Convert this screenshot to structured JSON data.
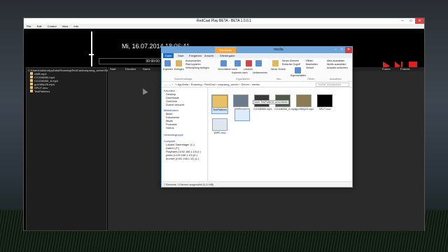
{
  "app": {
    "title": "RedCast Play BETA - BETA 1.0.0.1",
    "menu": [
      "File",
      "Edit",
      "Control",
      "View",
      "Info"
    ],
    "clock": "Mi, 16.07.2014 18:06:41",
    "time": "00:00:00",
    "accent": "#e02020"
  },
  "tree": {
    "root": "C:\\Users\\oddso\\AppData\\Roaming\\RedCast\\casparcg_server\\Server",
    "items": [
      "AMB.mp4",
      "CG1080i50.mp4",
      "CG1080i50_A.mp4",
      "go1080p25.mp4",
      "SPLIT.mov",
      "TestPatterns"
    ]
  },
  "columns": [
    "Start",
    "Duration",
    "Name",
    "Frame",
    "Frames"
  ],
  "explorer": {
    "title": "media",
    "context_tab": "Videotools",
    "tabs": [
      "Datei",
      "Start",
      "Freigeben",
      "Ansicht",
      "Wiedergabe"
    ],
    "ribbon": {
      "kopieren": "Kopieren",
      "einfuegen": "Einfügen",
      "ausschneiden": "Ausschneiden",
      "pfad": "Pfad kopieren",
      "verknuepfung": "Verknüpfung einfügen",
      "verschieben": "Verschieben nach",
      "kopieren_nach": "Kopieren nach",
      "loeschen": "Löschen",
      "umbenennen": "Umbenennen",
      "neuer_ordner": "Neuer Ordner",
      "neues_element": "Neues Element",
      "einfacher_zugriff": "Einfacher Zugriff",
      "eigenschaften": "Eigenschaften",
      "oeffnen": "Öffnen",
      "bearbeiten": "Bearbeiten",
      "verlauf": "Verlauf",
      "alles_auswaehlen": "Alles auswählen",
      "nichts_auswaehlen": "Nichts auswählen",
      "auswahl_umkehren": "Auswahl umkehren",
      "groups": [
        "Zwischenablage",
        "Organisieren",
        "Neu",
        "Öffnen",
        "Auswählen"
      ]
    },
    "address": "« AppData › Roaming › RedCast › casparcg_server › Server › media",
    "search": "\"media\" durchsuchen",
    "nav": {
      "favoriten": "Favoriten",
      "fav_items": [
        "Desktop",
        "Downloads",
        "OneDrive",
        "Zuletzt besucht"
      ],
      "bibliotheken": "Bibliotheken",
      "lib_items": [
        "Bilder",
        "Dokumente",
        "Musik",
        "Podcasts",
        "Videos"
      ],
      "heimnetz": "Heimnetzgruppe",
      "computer": "Computer",
      "comp_items": [
        "Lokaler Datenträger (C:)",
        "Daten1 (F:)",
        "Playlisten (\\\\192.168.1.10) (I:)",
        "public (\\\\192.168.1.10) (K:)",
        "Archive (\\\\192.168.1.10) (L:)"
      ]
    },
    "files": [
      "TestPatterns",
      "AMB.mp4",
      "CG1080i50.mp4",
      "CG1080i50_A.mp4",
      "go1080p25.mp4",
      "SPLIT.mov",
      "WIPE.mov"
    ],
    "tooltip": "Nach TestPatterns verschieben",
    "status": "7 Elemente    1 Element ausgewählt (6,14 MB)"
  }
}
